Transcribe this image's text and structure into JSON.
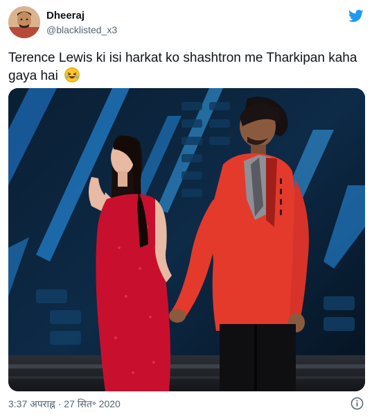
{
  "user": {
    "name": "Dheeraj",
    "handle": "@blacklisted_x3"
  },
  "tweet": {
    "text_line1": "Terence Lewis ki isi harkat ko shashtron me Tharkipan kaha",
    "text_line2": "gaya hai"
  },
  "timestamp": "3:37 अपराह्न · 27 सित॰ 2020",
  "icons": {
    "brand": "twitter-bird-icon",
    "emoji": "rofl-emoji",
    "info": "info-icon"
  },
  "colors": {
    "twitter_blue": "#1d9bf0",
    "secondary_text": "#536471",
    "dress_red": "#c8102e",
    "jacket_red": "#e43a2c"
  }
}
